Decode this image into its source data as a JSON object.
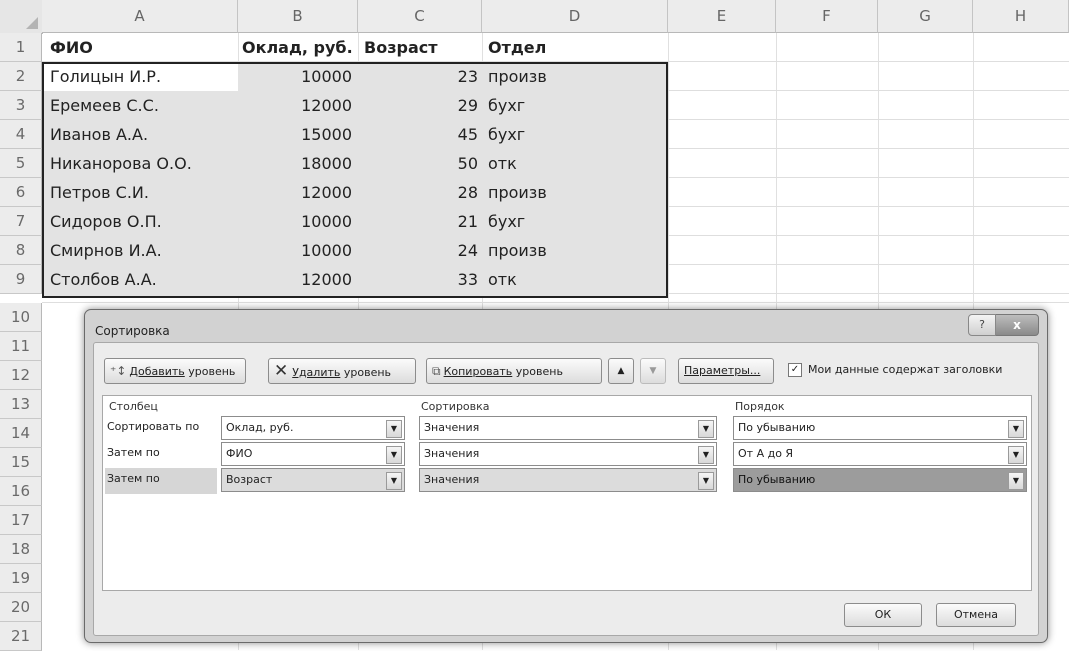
{
  "columns": [
    "A",
    "B",
    "C",
    "D",
    "E",
    "F",
    "G",
    "H"
  ],
  "rows": [
    "1",
    "2",
    "3",
    "4",
    "5",
    "6",
    "7",
    "8",
    "9",
    "10",
    "11",
    "12",
    "13",
    "14",
    "15",
    "16",
    "17",
    "18",
    "19",
    "20",
    "21"
  ],
  "header": {
    "fio": "ФИО",
    "salary": "Оклад, руб.",
    "age": "Возраст",
    "dept": "Отдел"
  },
  "records": [
    {
      "name": "Голицын И.Р.",
      "salary": "10000",
      "age": "23",
      "dept": "произв"
    },
    {
      "name": "Еремеев С.С.",
      "salary": "12000",
      "age": "29",
      "dept": "бухг"
    },
    {
      "name": "Иванов А.А.",
      "salary": "15000",
      "age": "45",
      "dept": "бухг"
    },
    {
      "name": "Никанорова О.О.",
      "salary": "18000",
      "age": "50",
      "dept": "отк"
    },
    {
      "name": "Петров С.И.",
      "salary": "12000",
      "age": "28",
      "dept": "произв"
    },
    {
      "name": "Сидоров О.П.",
      "salary": "10000",
      "age": "21",
      "dept": "бухг"
    },
    {
      "name": "Смирнов И.А.",
      "salary": "10000",
      "age": "24",
      "dept": "произв"
    },
    {
      "name": "Столбов А.А.",
      "salary": "12000",
      "age": "33",
      "dept": "отк"
    }
  ],
  "dialog": {
    "title": "Сортировка",
    "help": "?",
    "close": "x",
    "toolbar": {
      "add_pre": "Добавить",
      "add_post": " уровень",
      "delete_pre": "Удалить",
      "delete_post": " уровень",
      "copy_pre": "Копировать",
      "copy_post": " уровень",
      "up": "▲",
      "down": "▼",
      "params": "Параметры..."
    },
    "checkbox": {
      "checked": true,
      "label": "Мои данные содержат заголовки"
    },
    "headers": {
      "column": "Столбец",
      "sort_on": "Сортировка",
      "order": "Порядок"
    },
    "levels": [
      {
        "label": "Сортировать по",
        "column": "Оклад, руб.",
        "sort_on": "Значения",
        "order": "По убыванию"
      },
      {
        "label": "Затем по",
        "column": "ФИО",
        "sort_on": "Значения",
        "order": "От А до Я"
      },
      {
        "label": "Затем по",
        "column": "Возраст",
        "sort_on": "Значения",
        "order": "По убыванию"
      }
    ],
    "ok": "ОК",
    "cancel": "Отмена"
  }
}
